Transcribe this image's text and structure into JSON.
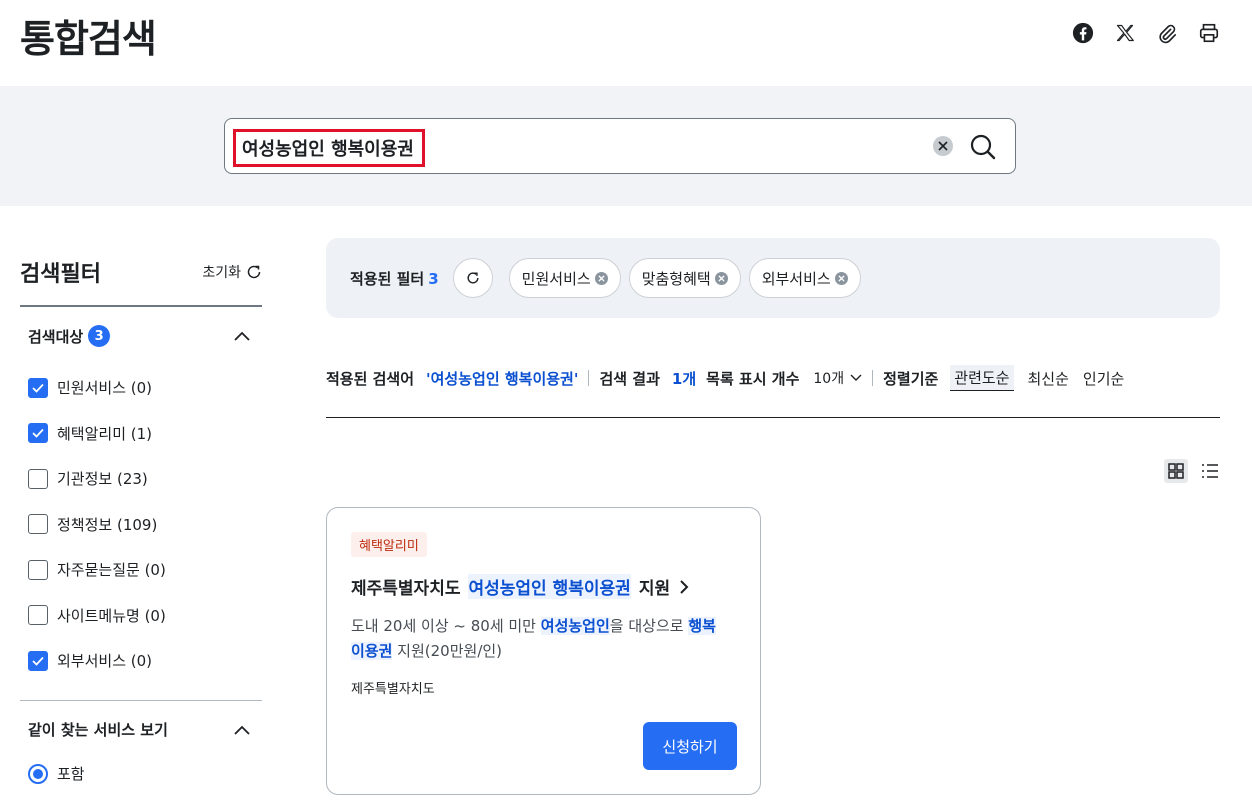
{
  "header": {
    "title": "통합검색",
    "tools": [
      {
        "icon": "facebook-icon"
      },
      {
        "icon": "x-icon"
      },
      {
        "icon": "link-icon"
      },
      {
        "icon": "print-icon"
      }
    ]
  },
  "search": {
    "value": "여성농업인 행복이용권",
    "placeholder": ""
  },
  "filter": {
    "title": "검색필터",
    "reset_label": "초기화",
    "target": {
      "title": "검색대상",
      "count": "3",
      "items": [
        {
          "label": "민원서비스 (0)",
          "checked": true
        },
        {
          "label": "혜택알리미 (1)",
          "checked": true
        },
        {
          "label": "기관정보 (23)",
          "checked": false
        },
        {
          "label": "정책정보 (109)",
          "checked": false
        },
        {
          "label": "자주묻는질문 (0)",
          "checked": false
        },
        {
          "label": "사이트메뉴명 (0)",
          "checked": false
        },
        {
          "label": "외부서비스 (0)",
          "checked": true
        }
      ]
    },
    "together": {
      "title": "같이 찾는 서비스 보기",
      "option": "포함"
    }
  },
  "applied": {
    "label": "적용된 필터",
    "count": "3",
    "chips": [
      "민원서비스",
      "맞춤형혜택",
      "외부서비스"
    ]
  },
  "result_bar": {
    "query_label": "적용된 검색어",
    "query_value": "'여성농업인 행복이용권'",
    "result_label": "검색 결과",
    "result_count": "1개",
    "per_page_label": "목록 표시 개수",
    "per_page_value": "10개",
    "sort_label": "정렬기준",
    "sort_options": [
      "관련도순",
      "최신순",
      "인기순"
    ],
    "sort_active": "관련도순"
  },
  "card": {
    "tag": "혜택알리미",
    "title_prefix": "제주특별자치도",
    "title_highlight": "여성농업인 행복이용권",
    "title_suffix": "지원",
    "desc_1": "도내 20세 이상 ~ 80세 미만 ",
    "desc_hl_1": "여성농업인",
    "desc_2": "을 대상으로 ",
    "desc_hl_2a": "행복",
    "desc_hl_2b": "이용권",
    "desc_3": " 지원(20만원/인)",
    "org": "제주특별자치도",
    "apply_label": "신청하기"
  },
  "colors": {
    "accent": "#256ef4",
    "highlight_text": "#0b50d0",
    "search_band": "#f1f3f6",
    "tag_bg": "#fdefec",
    "tag_text": "#bd2c0f"
  }
}
